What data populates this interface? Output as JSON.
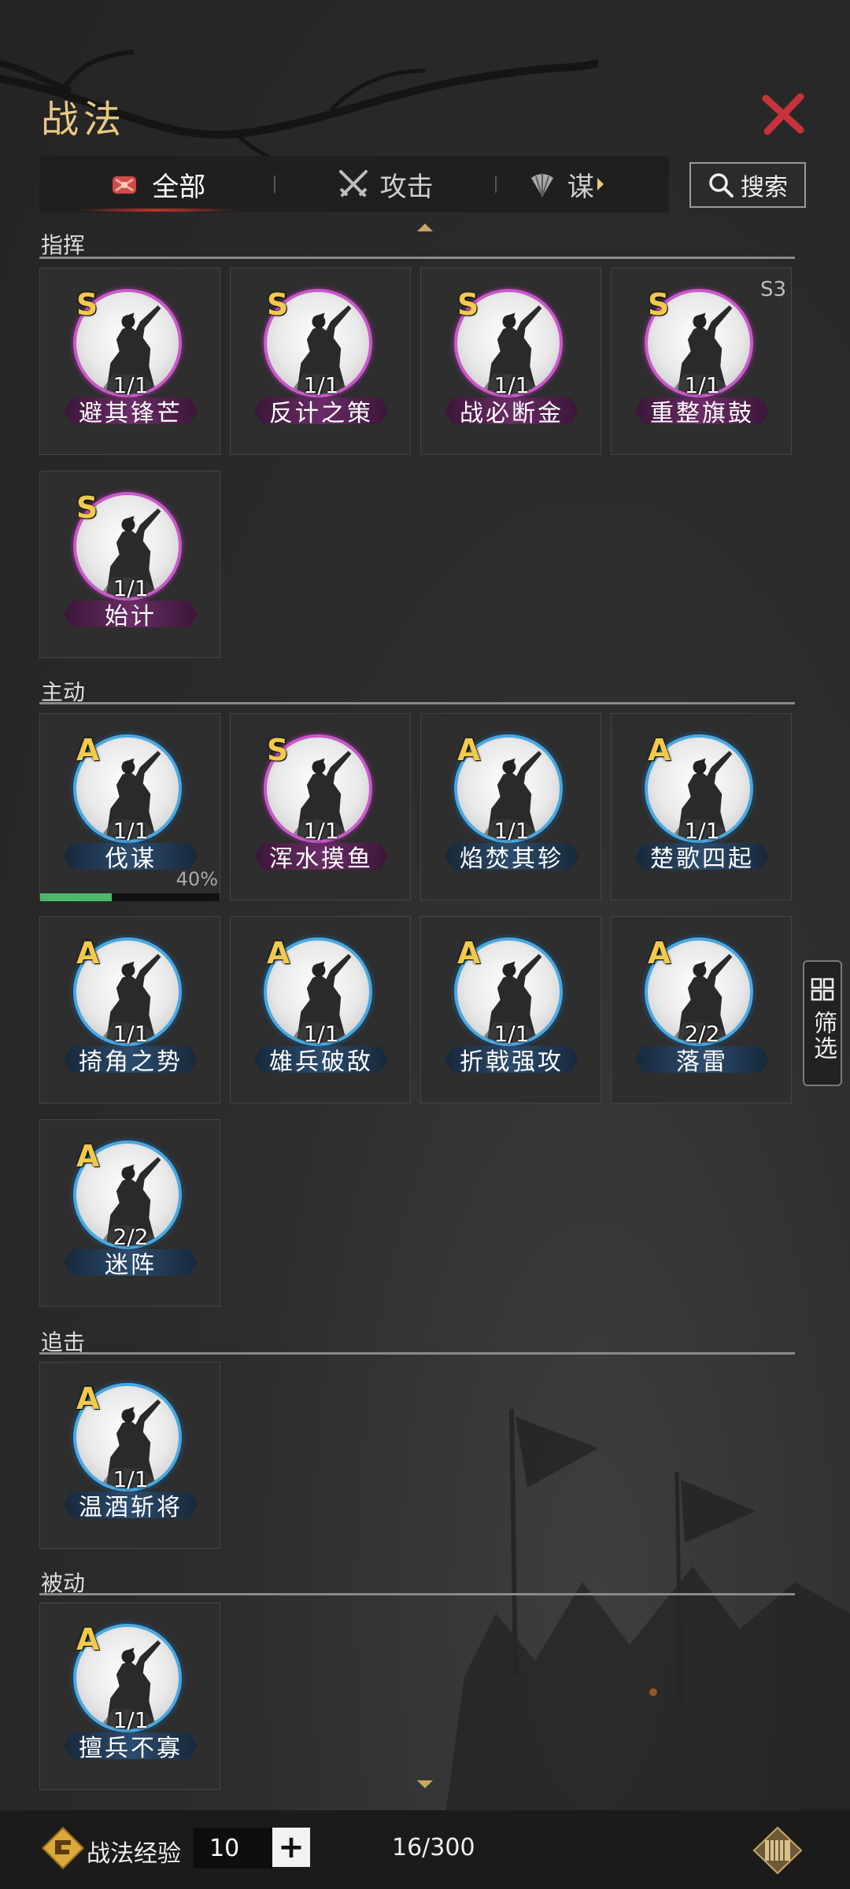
{
  "header": {
    "title": "战法"
  },
  "tabs": [
    {
      "label": "全部",
      "icon": "scroll-icon",
      "active": true
    },
    {
      "label": "攻击",
      "icon": "crossed-swords-icon",
      "active": false
    },
    {
      "label": "谋",
      "icon": "feather-fan-icon",
      "active": false
    }
  ],
  "search": {
    "label": "搜索"
  },
  "sections": {
    "command": {
      "title": "指挥"
    },
    "active": {
      "title": "主动"
    },
    "pursuit": {
      "title": "追击"
    },
    "passive": {
      "title": "被动"
    }
  },
  "cards": [
    {
      "grade": "S",
      "count": "1/1",
      "name": "避其锋芒"
    },
    {
      "grade": "S",
      "count": "1/1",
      "name": "反计之策"
    },
    {
      "grade": "S",
      "count": "1/1",
      "name": "战必断金"
    },
    {
      "grade": "S",
      "count": "1/1",
      "name": "重整旗鼓",
      "season": "S3"
    },
    {
      "grade": "S",
      "count": "1/1",
      "name": "始计"
    },
    {
      "grade": "A",
      "count": "1/1",
      "name": "伐谋",
      "progress_text": "40%",
      "progress": 0.4
    },
    {
      "grade": "S",
      "count": "1/1",
      "name": "浑水摸鱼"
    },
    {
      "grade": "A",
      "count": "1/1",
      "name": "焰焚其轸"
    },
    {
      "grade": "A",
      "count": "1/1",
      "name": "楚歌四起"
    },
    {
      "grade": "A",
      "count": "1/1",
      "name": "掎角之势"
    },
    {
      "grade": "A",
      "count": "1/1",
      "name": "雄兵破敌"
    },
    {
      "grade": "A",
      "count": "1/1",
      "name": "折戟强攻"
    },
    {
      "grade": "A",
      "count": "2/2",
      "name": "落雷"
    },
    {
      "grade": "A",
      "count": "2/2",
      "name": "迷阵"
    },
    {
      "grade": "A",
      "count": "1/1",
      "name": "温酒斩将"
    },
    {
      "grade": "A",
      "count": "1/1",
      "name": "擅兵不寡"
    }
  ],
  "filter": {
    "label": "筛选"
  },
  "bottom": {
    "exp_label": "战法经验",
    "exp_value": "10",
    "plus": "+",
    "capacity": "16/300"
  },
  "colors": {
    "title_gold": "#e9c982",
    "grade_gold": "#f2c94a",
    "s_ring": "#c85ac8",
    "a_ring": "#4aa8e0",
    "close_red": "#c8323a",
    "progress_green": "#4eb86a"
  }
}
